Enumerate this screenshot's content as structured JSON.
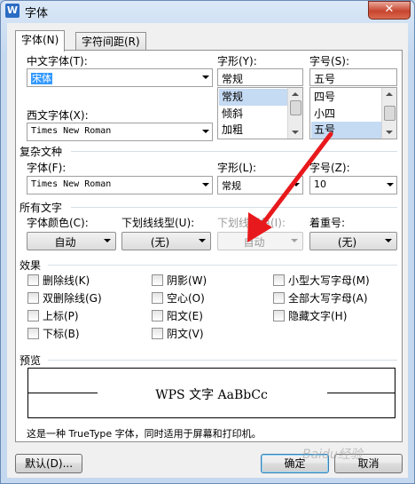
{
  "window": {
    "title": "字体",
    "close_glyph": "✕",
    "app_icon_letter": "W"
  },
  "tabs": [
    {
      "label": "字体(N)",
      "active": true
    },
    {
      "label": "字符间距(R)",
      "active": false
    }
  ],
  "font": {
    "cn_font_label": "中文字体(T):",
    "cn_font_value": "宋体",
    "style_label": "字形(Y):",
    "style_value": "常规",
    "style_options": [
      "常规",
      "倾斜",
      "加粗"
    ],
    "style_selected": "常规",
    "size_label": "字号(S):",
    "size_value": "五号",
    "size_options": [
      "四号",
      "小四",
      "五号"
    ],
    "size_selected": "五号",
    "west_font_label": "西文字体(X):",
    "west_font_value": "Times New Roman"
  },
  "complex": {
    "section_label": "复杂文种",
    "font_label": "字体(F):",
    "font_value": "Times New Roman",
    "style_label": "字形(L):",
    "style_value": "常规",
    "size_label": "字号(Z):",
    "size_value": "10"
  },
  "all_text": {
    "section_label": "所有文字",
    "color_label": "字体颜色(C):",
    "color_value": "自动",
    "underline_label": "下划线线型(U):",
    "underline_value": "(无)",
    "underline_color_label": "下划线颜色(I):",
    "underline_color_value": "自动",
    "emphasis_label": "着重号:",
    "emphasis_value": "(无)"
  },
  "effects": {
    "section_label": "效果",
    "items": [
      "删除线(K)",
      "双删除线(G)",
      "上标(P)",
      "下标(B)",
      "阴影(W)",
      "空心(O)",
      "阳文(E)",
      "阴文(V)",
      "小型大写字母(M)",
      "全部大写字母(A)",
      "隐藏文字(H)"
    ]
  },
  "preview": {
    "section_label": "预览",
    "sample": "WPS 文字 AaBbCc",
    "note": "这是一种 TrueType 字体，同时适用于屏幕和打印机。"
  },
  "buttons": {
    "default": "默认(D)...",
    "ok": "确定",
    "cancel": "取消"
  },
  "watermark": "Baidu经验",
  "colors": {
    "annotation_arrow": "#e8191c",
    "selection": "#3399ff"
  }
}
